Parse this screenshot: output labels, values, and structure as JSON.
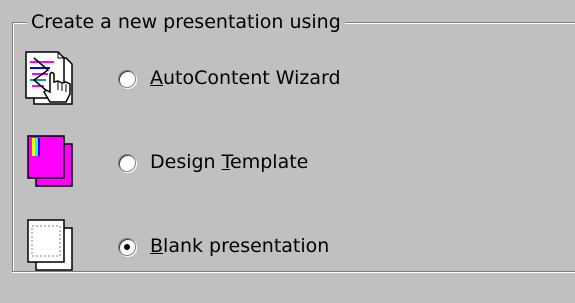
{
  "group": {
    "legend": "Create a new presentation using"
  },
  "options": [
    {
      "label_pre": "",
      "accel": "A",
      "label_post": "utoContent Wizard",
      "selected": false,
      "icon": "autocontent-wizard-icon"
    },
    {
      "label_pre": "Design ",
      "accel": "T",
      "label_post": "emplate",
      "selected": false,
      "icon": "design-template-icon"
    },
    {
      "label_pre": "",
      "accel": "B",
      "label_post": "lank presentation",
      "selected": true,
      "icon": "blank-presentation-icon"
    }
  ],
  "colors": {
    "background": "#c0c0c0",
    "template_magenta": "#ff00ff",
    "wizard_blue": "#0000ff"
  }
}
